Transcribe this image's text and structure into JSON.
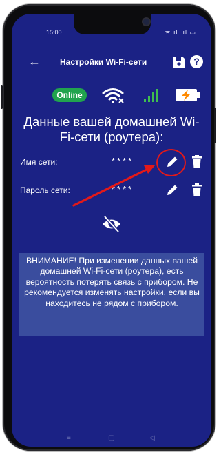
{
  "status_bar": {
    "time": "15:00",
    "icons": "ᯤ.ıl .ıl ▭"
  },
  "app_bar": {
    "title": "Настройки Wi-Fi-сети",
    "back_icon": "arrow-left-icon",
    "save_icon": "floppy-save-icon",
    "help_label": "?"
  },
  "device_status": {
    "online_label": "Online",
    "wifi_icon": "wifi-off-icon",
    "signal_icon": "signal-bars-icon",
    "battery_icon": "battery-charging-icon",
    "colors": {
      "online": "#21a34e",
      "signal": "#3fbf4f",
      "battery": "#ffffff",
      "bolt": "#ff8a00"
    }
  },
  "heading": "Данные вашей домашней Wi-Fi-сети (роутера):",
  "fields": [
    {
      "label": "Имя сети:",
      "value": "****"
    },
    {
      "label": "Пароль сети:",
      "value": "****"
    }
  ],
  "visibility_icon": "eye-off-icon",
  "warning": "ВНИМАНИЕ! При изменении данных вашей домашней Wi-Fi-сети (роутера), есть вероятность потерять связь с прибором. Не рекомендуется изменять настройки, если вы находитесь не рядом с прибором.",
  "nav": {
    "menu": "≡",
    "home": "▢",
    "back": "◁"
  },
  "colors": {
    "background": "#1b2285",
    "warning_background": "#3a4d9e",
    "annotation": "#e31919"
  }
}
